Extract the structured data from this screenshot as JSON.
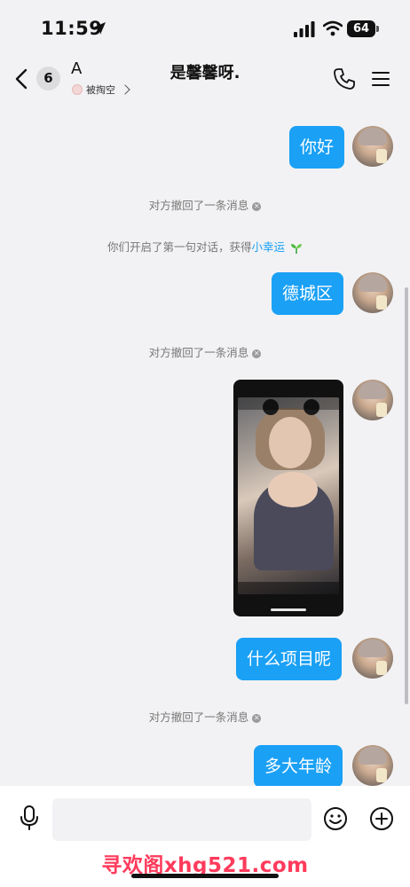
{
  "status_bar": {
    "time": "11:59",
    "battery": "64"
  },
  "header": {
    "back_count": "6",
    "contact_name": "A",
    "contact_sub": "被掏空",
    "title": "是馨馨呀."
  },
  "messages": [
    {
      "type": "text",
      "text": "你好"
    },
    {
      "type": "system",
      "text": "对方撤回了一条消息"
    },
    {
      "type": "system",
      "text": "你们开启了第一句对话，获得",
      "link": "小幸运"
    },
    {
      "type": "text",
      "text": "德城区"
    },
    {
      "type": "system",
      "text": "对方撤回了一条消息"
    },
    {
      "type": "video"
    },
    {
      "type": "text",
      "text": "什么项目呢"
    },
    {
      "type": "system",
      "text": "对方撤回了一条消息"
    },
    {
      "type": "text",
      "text": "多大年龄"
    }
  ],
  "input": {
    "placeholder": ""
  },
  "watermark": "寻欢阁xhg521.com",
  "icons": [
    "location-arrow-icon",
    "signal-icon",
    "wifi-icon",
    "back-chevron-icon",
    "phone-icon",
    "menu-icon",
    "close-icon",
    "sprout-icon",
    "microphone-icon",
    "emoji-icon",
    "plus-icon"
  ],
  "colors": {
    "bubble": "#1aa0f5",
    "background": "#f2f2f4",
    "link": "#1aa0f5",
    "watermark": "#ff3b5c"
  }
}
